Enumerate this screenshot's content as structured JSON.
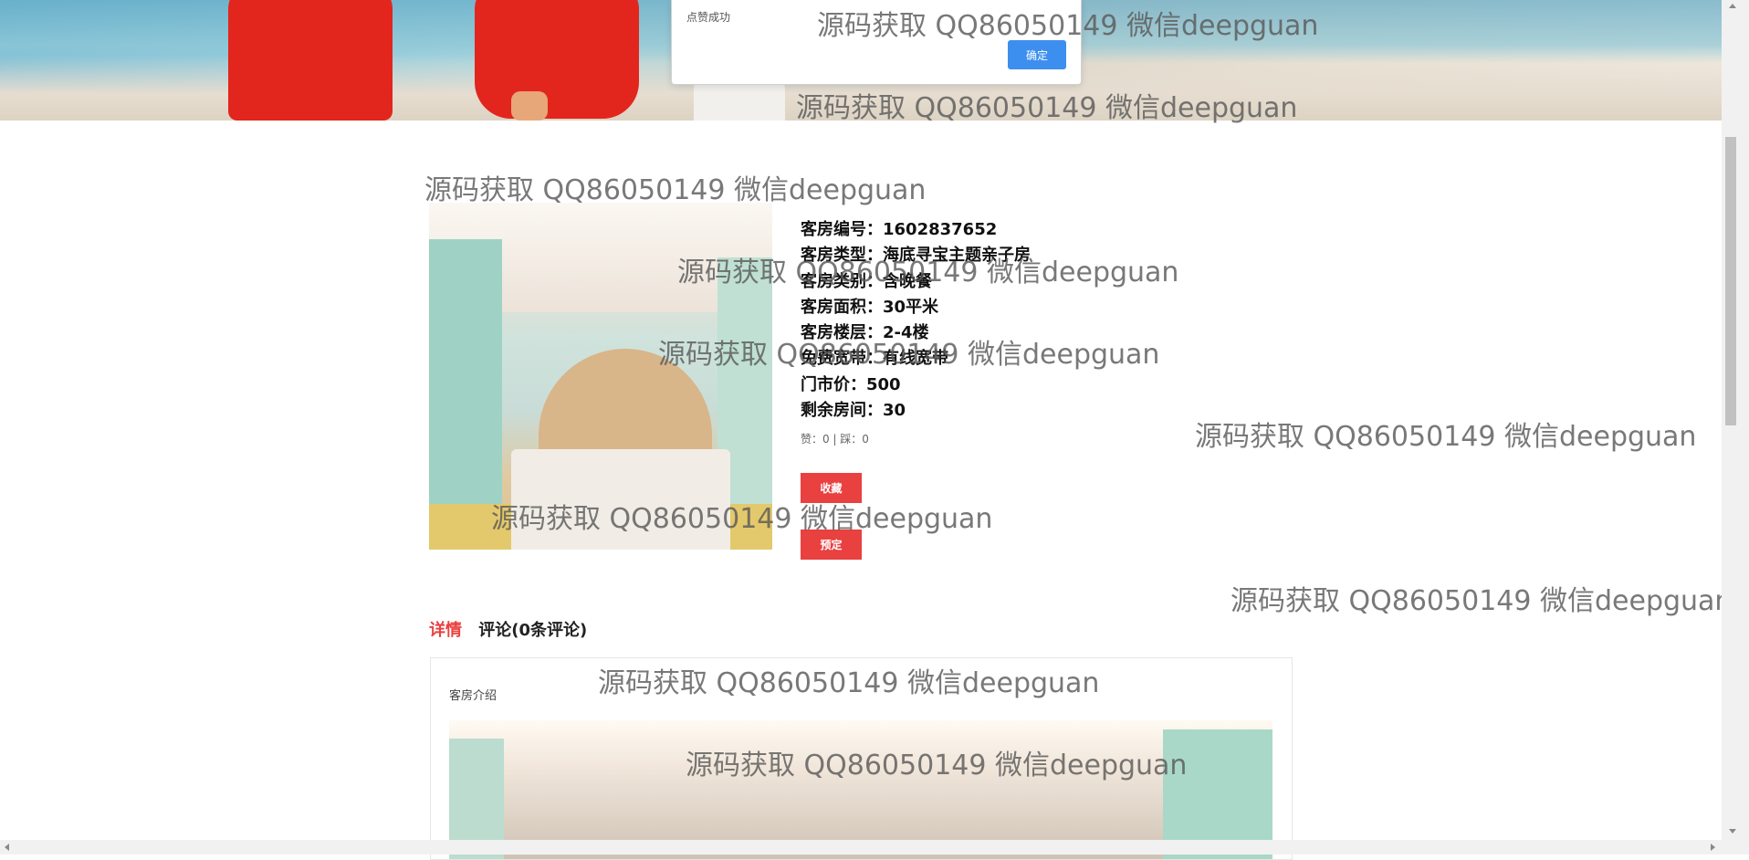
{
  "dialog": {
    "message": "点赞成功",
    "ok_label": "确定"
  },
  "room": {
    "fields": [
      {
        "label": "客房编号：",
        "value": "1602837652"
      },
      {
        "label": "客房类型：",
        "value": "海底寻宝主题亲子房"
      },
      {
        "label": "客房类别：",
        "value": "含晚餐"
      },
      {
        "label": "客房面积：",
        "value": "30平米"
      },
      {
        "label": "客房楼层：",
        "value": "2-4楼"
      },
      {
        "label": "免费宽带：",
        "value": "有线宽带"
      },
      {
        "label": "门市价：",
        "value": "500"
      },
      {
        "label": "剩余房间：",
        "value": "30"
      }
    ],
    "votes": "赞：0 | 踩：0",
    "favorite_label": "收藏",
    "book_label": "预定"
  },
  "tabs": [
    {
      "label": "详情"
    },
    {
      "label": "评论(0条评论)"
    }
  ],
  "detail": {
    "intro_label": "客房介绍"
  },
  "watermark": "源码获取 QQ86050149 微信deepguan"
}
